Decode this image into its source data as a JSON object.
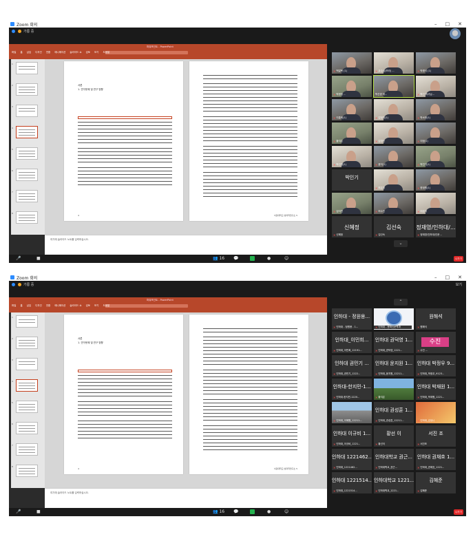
{
  "window": {
    "title": "Zoom 회의",
    "min": "–",
    "max": "□",
    "close": "✕"
  },
  "meeting": {
    "host_label": "가롱 중",
    "view_label": "보기"
  },
  "ppt": {
    "title": "파워포인트 - PowerPoint",
    "search": "검색",
    "tabs": [
      "파일",
      "홈",
      "삽입",
      "디자인",
      "전환",
      "애니메이션",
      "슬라이드 쇼",
      "검토",
      "보기",
      "도움말"
    ]
  },
  "slides": {
    "heading_line1": "서론",
    "heading_line2": "1. 연구문제 및 연구 방향",
    "notes": "여기에 슬라이드 노트를 입력하십시오.",
    "page_left": "4",
    "page_right": "서강대학교 성과학연구소 5"
  },
  "thumbs": [
    "1",
    "2",
    "3",
    "4",
    "5",
    "6",
    "7",
    "8"
  ],
  "top": {
    "tiles": [
      {
        "name": "백말목 (1)"
      },
      {
        "name": "교수님(보라) ..."
      },
      {
        "name": "박병석 (1)"
      },
      {
        "name": "박현정 ..."
      },
      {
        "name": "박선경 하..."
      },
      {
        "name": "박선 박사님..."
      },
      {
        "name": "이홍희(1)"
      },
      {
        "name": "김정미(1)"
      },
      {
        "name": "박소현(1)"
      },
      {
        "name": "황지은"
      },
      {
        "name": "김영선"
      },
      {
        "name": "이정(1)"
      },
      {
        "name": "박선경(1)"
      },
      {
        "name": "윤지(1)"
      },
      {
        "name": "박진기(1)"
      },
      {
        "name": "박인기"
      },
      {
        "name": "최은경"
      },
      {
        "name": "한정원(1)"
      },
      {
        "name": "김지연"
      },
      {
        "name": "허수진"
      },
      {
        "name": "이은아"
      }
    ],
    "name_tiles": [
      {
        "big": "신혜정",
        "name": "신혜정"
      },
      {
        "big": "김선숙",
        "name": "김선숙"
      },
      {
        "big": "정재영/인하대/...",
        "name": "정재영/인하대/인문..."
      }
    ]
  },
  "bottom": {
    "tiles": [
      {
        "big": "인하대 - 정원용...",
        "name": "인하대 - 정원용 - 1..."
      },
      {
        "big": "",
        "name": "인하대 - 문화인문학과"
      },
      {
        "big": "원해석",
        "name": "원해석"
      },
      {
        "big": "인하대_이민희...",
        "name": "인하대_이민희_12191..."
      },
      {
        "big": "인하대 권덕영 1...",
        "name": "인하대_권덕영_1221..."
      },
      {
        "big": "수진",
        "name": "수진 ..."
      },
      {
        "big": "인하대 권민기 ...",
        "name": "인하대_권민기_1222..."
      },
      {
        "big": "인하대 윤지원 1...",
        "name": "인하대_윤지원_12211..."
      },
      {
        "big": "인하대 박정우 9...",
        "name": "인하대_박정우_9123..."
      },
      {
        "big": "인하대-한지민-1...",
        "name": "인하대-한지민-1220..."
      },
      {
        "big": "",
        "name": "황지은"
      },
      {
        "big": "인하대 박재원 1...",
        "name": "인하대_박재원_1221..."
      },
      {
        "big": "",
        "name": "인하대_이혜원_12211..."
      },
      {
        "big": "인하대 권성훈 1...",
        "name": "인하대_권성훈_12211..."
      },
      {
        "big": "",
        "name": "인하대_김유나"
      },
      {
        "big": "인하대 이규비 1...",
        "name": "인하대_이규비_1221..."
      },
      {
        "big": "황선 이",
        "name": "황선이"
      },
      {
        "big": "서진 조",
        "name": "서진조"
      },
      {
        "big": "인하대 1221462...",
        "name": "인하대_1221462..."
      },
      {
        "big": "인하대학교 권근...",
        "name": "인하대학교_권근..."
      },
      {
        "big": "인하대 권채흐 1...",
        "name": "인하대_권채흐_1221..."
      },
      {
        "big": "인하대 1221514...",
        "name": "인하대_1221514..."
      },
      {
        "big": "인하대학교 1221...",
        "name": "인하대학교_1221..."
      },
      {
        "big": "김혜준",
        "name": "김혜준"
      }
    ]
  },
  "controls": {
    "mute": "🎤",
    "video": "■",
    "participants": "👥",
    "participants_count": "16",
    "chat": "💬",
    "share": "↑",
    "record": "●",
    "reactions": "☺",
    "leave": "나가기"
  },
  "colors": {
    "ppt_ribbon": "#b7472a",
    "zoom_blue": "#2d8cff",
    "leave_red": "#e02828",
    "share_green": "#23b14d",
    "active_speaker": "#b7e34a"
  }
}
